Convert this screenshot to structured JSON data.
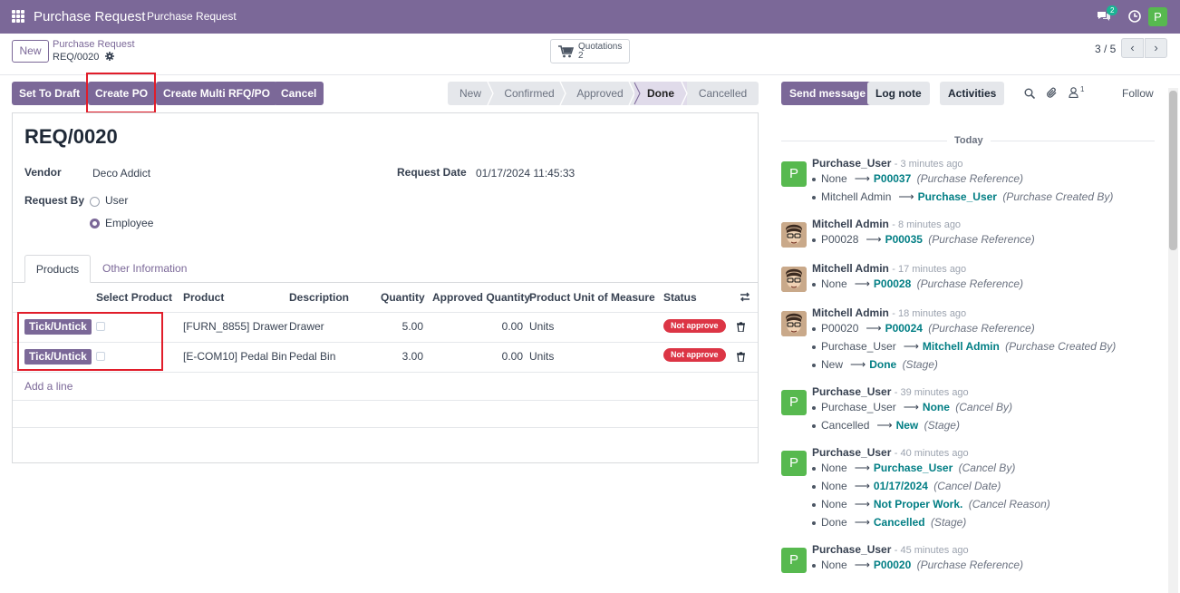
{
  "topbar": {
    "app_title": "Purchase Request",
    "menu_item": "Purchase Request",
    "chat_count": "2",
    "user_initial": "P"
  },
  "control_panel": {
    "new_label": "New",
    "breadcrumb_parent": "Purchase Request",
    "breadcrumb_current": "REQ/0020",
    "quotations_label": "Quotations",
    "quotations_count": "2",
    "pager": "3 / 5"
  },
  "actions": {
    "set_to_draft": "Set To Draft",
    "create_po": "Create PO",
    "create_multi": "Create Multi RFQ/PO",
    "cancel": "Cancel"
  },
  "stages": [
    "New",
    "Confirmed",
    "Approved",
    "Done",
    "Cancelled"
  ],
  "active_stage": "Done",
  "form": {
    "title": "REQ/0020",
    "vendor_label": "Vendor",
    "vendor": "Deco Addict",
    "request_date_label": "Request Date",
    "request_date": "01/17/2024 11:45:33",
    "request_by_label": "Request By",
    "request_by_options": [
      "User",
      "Employee"
    ],
    "request_by_selected": "Employee",
    "tabs": [
      "Products",
      "Other Information"
    ],
    "columns": [
      "Select Product",
      "Product",
      "Description",
      "Quantity",
      "Approved Quantity",
      "Product Unit of Measure",
      "Status"
    ],
    "tick_label": "Tick/Untick",
    "lines": [
      {
        "product": "[FURN_8855] Drawer",
        "description": "Drawer",
        "quantity": "5.00",
        "approved_quantity": "0.00",
        "uom": "Units",
        "status": "Not approve"
      },
      {
        "product": "[E-COM10] Pedal Bin",
        "description": "Pedal Bin",
        "quantity": "3.00",
        "approved_quantity": "0.00",
        "uom": "Units",
        "status": "Not approve"
      }
    ],
    "add_line": "Add a line"
  },
  "chatter": {
    "send_message": "Send message",
    "log_note": "Log note",
    "activities": "Activities",
    "follower_count": "1",
    "follow": "Follow",
    "date_separator": "Today",
    "messages": [
      {
        "author": "Purchase_User",
        "time": "- 3 minutes ago",
        "avatar": "P",
        "changes": [
          {
            "old": "None",
            "new": "P00037",
            "field": "(Purchase Reference)"
          },
          {
            "old": "Mitchell Admin",
            "new": "Purchase_User",
            "field": "(Purchase Created By)"
          }
        ]
      },
      {
        "author": "Mitchell Admin",
        "time": "- 8 minutes ago",
        "avatar": "face",
        "changes": [
          {
            "old": "P00028",
            "new": "P00035",
            "field": "(Purchase Reference)"
          }
        ]
      },
      {
        "author": "Mitchell Admin",
        "time": "- 17 minutes ago",
        "avatar": "face",
        "changes": [
          {
            "old": "None",
            "new": "P00028",
            "field": "(Purchase Reference)"
          }
        ]
      },
      {
        "author": "Mitchell Admin",
        "time": "- 18 minutes ago",
        "avatar": "face",
        "changes": [
          {
            "old": "P00020",
            "new": "P00024",
            "field": "(Purchase Reference)"
          },
          {
            "old": "Purchase_User",
            "new": "Mitchell Admin",
            "field": "(Purchase Created By)"
          },
          {
            "old": "New",
            "new": "Done",
            "field": "(Stage)"
          }
        ]
      },
      {
        "author": "Purchase_User",
        "time": "- 39 minutes ago",
        "avatar": "P",
        "changes": [
          {
            "old": "Purchase_User",
            "new": "None",
            "field": "(Cancel By)"
          },
          {
            "old": "Cancelled",
            "new": "New",
            "field": "(Stage)"
          }
        ]
      },
      {
        "author": "Purchase_User",
        "time": "- 40 minutes ago",
        "avatar": "P",
        "changes": [
          {
            "old": "None",
            "new": "Purchase_User",
            "field": "(Cancel By)"
          },
          {
            "old": "None",
            "new": "01/17/2024",
            "field": "(Cancel Date)"
          },
          {
            "old": "None",
            "new": "Not Proper Work.",
            "field": "(Cancel Reason)"
          },
          {
            "old": "Done",
            "new": "Cancelled",
            "field": "(Stage)"
          }
        ]
      },
      {
        "author": "Purchase_User",
        "time": "- 45 minutes ago",
        "avatar": "P",
        "changes": [
          {
            "old": "None",
            "new": "P00020",
            "field": "(Purchase Reference)"
          }
        ]
      }
    ]
  },
  "colors": {
    "brand": "#7b6898",
    "link": "#017e84",
    "danger": "#dc3545",
    "highlight": "#e11d2a"
  }
}
